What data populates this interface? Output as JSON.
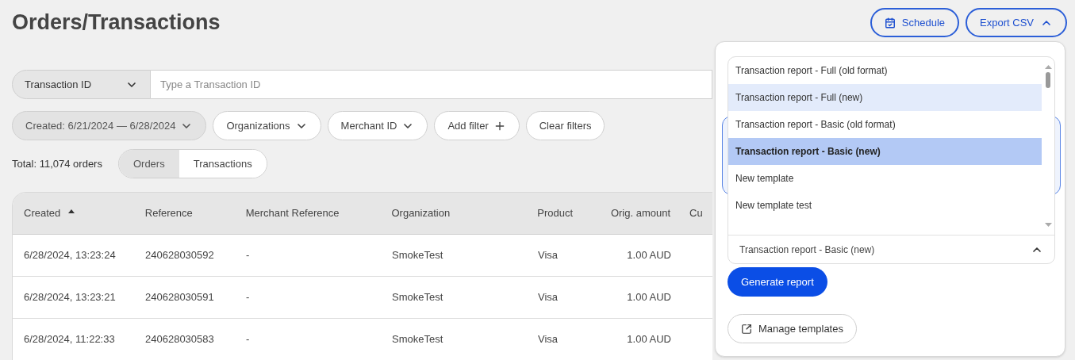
{
  "page_title": "Orders/Transactions",
  "header_buttons": [
    {
      "kind": "schedule",
      "label": "Schedule"
    },
    {
      "kind": "export",
      "label": "Export CSV",
      "expanded": true
    }
  ],
  "search": {
    "field_type": "Transaction ID",
    "placeholder": "Type a Transaction ID"
  },
  "filters": [
    {
      "label": "Created: 6/21/2024 — 6/28/2024",
      "kind": "dropdown",
      "active": true
    },
    {
      "label": "Organizations",
      "kind": "dropdown",
      "active": false
    },
    {
      "label": "Merchant ID",
      "kind": "dropdown",
      "active": false
    },
    {
      "label": "Add filter",
      "kind": "add",
      "active": false
    },
    {
      "label": "Clear filters",
      "kind": "plain",
      "active": false
    }
  ],
  "total": "Total: 11,074 orders",
  "view_tabs": [
    {
      "label": "Orders",
      "selected": true
    },
    {
      "label": "Transactions",
      "selected": false
    }
  ],
  "table": {
    "columns": [
      {
        "label": "Created",
        "sorted": true
      },
      {
        "label": "Reference",
        "sorted": false
      },
      {
        "label": "Merchant Reference",
        "sorted": false
      },
      {
        "label": "Organization",
        "sorted": false
      },
      {
        "label": "Product",
        "sorted": false
      },
      {
        "label": "Orig. amount",
        "sorted": false
      },
      {
        "label": "Cu",
        "sorted": false
      }
    ],
    "rows": [
      [
        "6/28/2024, 13:23:24",
        "240628030592",
        "-",
        "SmokeTest",
        "Visa",
        "1.00 AUD"
      ],
      [
        "6/28/2024, 13:23:21",
        "240628030591",
        "-",
        "SmokeTest",
        "Visa",
        "1.00 AUD"
      ],
      [
        "6/28/2024, 11:22:33",
        "240628030583",
        "-",
        "SmokeTest",
        "Visa",
        "1.00 AUD"
      ]
    ]
  },
  "export_panel": {
    "options": [
      {
        "label": "Transaction report - Full (old format)",
        "selected": false,
        "highlighted": false
      },
      {
        "label": "Transaction report - Full (new)",
        "selected": false,
        "highlighted": true
      },
      {
        "label": "Transaction report - Basic (old format)",
        "selected": false,
        "highlighted": false
      },
      {
        "label": "Transaction report - Basic (new)",
        "selected": true,
        "highlighted": false
      },
      {
        "label": "New template",
        "selected": false,
        "highlighted": false
      },
      {
        "label": "New template test",
        "selected": false,
        "highlighted": false
      }
    ],
    "select_value": "Transaction report - Basic (new)",
    "select_expanded": true,
    "generate_button": "Generate report",
    "manage_button": "Manage templates"
  }
}
